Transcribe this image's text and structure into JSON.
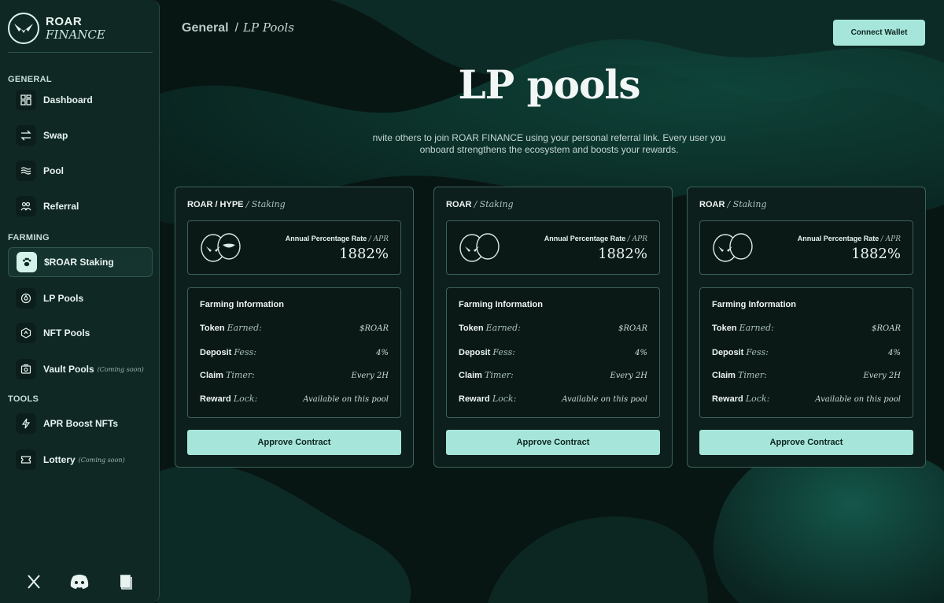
{
  "brand": {
    "line1": "ROAR",
    "line2": "FINANCE"
  },
  "sidebar": {
    "sections": [
      {
        "label": "GENERAL",
        "items": [
          {
            "label": "Dashboard",
            "icon": "grid-icon"
          },
          {
            "label": "Swap",
            "icon": "swap-arrows-icon"
          },
          {
            "label": "Pool",
            "icon": "waves-icon"
          },
          {
            "label": "Referral",
            "icon": "users-icon"
          }
        ]
      },
      {
        "label": "FARMING",
        "items": [
          {
            "label": "$ROAR Staking",
            "icon": "paw-icon",
            "active": true
          },
          {
            "label": "LP Pools",
            "icon": "pool-drop-icon"
          },
          {
            "label": "NFT Pools",
            "icon": "hexagon-icon"
          },
          {
            "label": "Vault Pools",
            "icon": "vault-icon",
            "badge": "(Coming soon)"
          }
        ]
      },
      {
        "label": "TOOLS",
        "items": [
          {
            "label": "APR Boost NFTs",
            "icon": "bolt-icon"
          },
          {
            "label": "Lottery",
            "icon": "ticket-icon",
            "badge": "(Coming soon)"
          }
        ]
      }
    ],
    "social": [
      "x-icon",
      "discord-icon",
      "book-icon"
    ]
  },
  "header": {
    "breadcrumb_root": "General",
    "breadcrumb_sep": "/",
    "breadcrumb_current": "LP Pools",
    "connect_label": "Connect Wallet"
  },
  "page": {
    "title": "LP pools",
    "description": "nvite others to join ROAR FINANCE using your personal referral link. Every user you onboard strengthens the ecosystem and boosts your rewards."
  },
  "cards": [
    {
      "pair": "ROAR / HYPE",
      "pair_suffix": "/ Staking",
      "apr_label": "Annual Percentage Rate",
      "apr_suffix": "/ APR",
      "apr_value": "1882%",
      "farm_title": "Farming Information",
      "rows": [
        {
          "key": "Token",
          "key_it": "Earned:",
          "value": "$ROAR"
        },
        {
          "key": "Deposit",
          "key_it": "Fess:",
          "value": "4%"
        },
        {
          "key": "Claim",
          "key_it": "Timer:",
          "value": "Every 2H"
        },
        {
          "key": "Reward",
          "key_it": "Lock:",
          "value": "Available on this pool"
        }
      ],
      "button": "Approve Contract"
    },
    {
      "pair": "ROAR",
      "pair_suffix": "/ Staking",
      "apr_label": "Annual Percentage Rate",
      "apr_suffix": "/ APR",
      "apr_value": "1882%",
      "farm_title": "Farming Information",
      "rows": [
        {
          "key": "Token",
          "key_it": "Earned:",
          "value": "$ROAR"
        },
        {
          "key": "Deposit",
          "key_it": "Fess:",
          "value": "4%"
        },
        {
          "key": "Claim",
          "key_it": "Timer:",
          "value": "Every 2H"
        },
        {
          "key": "Reward",
          "key_it": "Lock:",
          "value": "Available on this pool"
        }
      ],
      "button": "Approve Contract"
    },
    {
      "pair": "ROAR",
      "pair_suffix": "/ Staking",
      "apr_label": "Annual Percentage Rate",
      "apr_suffix": "/ APR",
      "apr_value": "1882%",
      "farm_title": "Farming Information",
      "rows": [
        {
          "key": "Token",
          "key_it": "Earned:",
          "value": "$ROAR"
        },
        {
          "key": "Deposit",
          "key_it": "Fess:",
          "value": "4%"
        },
        {
          "key": "Claim",
          "key_it": "Timer:",
          "value": "Every 2H"
        },
        {
          "key": "Reward",
          "key_it": "Lock:",
          "value": "Available on this pool"
        }
      ],
      "button": "Approve Contract"
    }
  ],
  "colors": {
    "accent": "#a6e6da",
    "background": "#0a1a17",
    "panel": "#0f2824",
    "border": "#3a625a"
  }
}
